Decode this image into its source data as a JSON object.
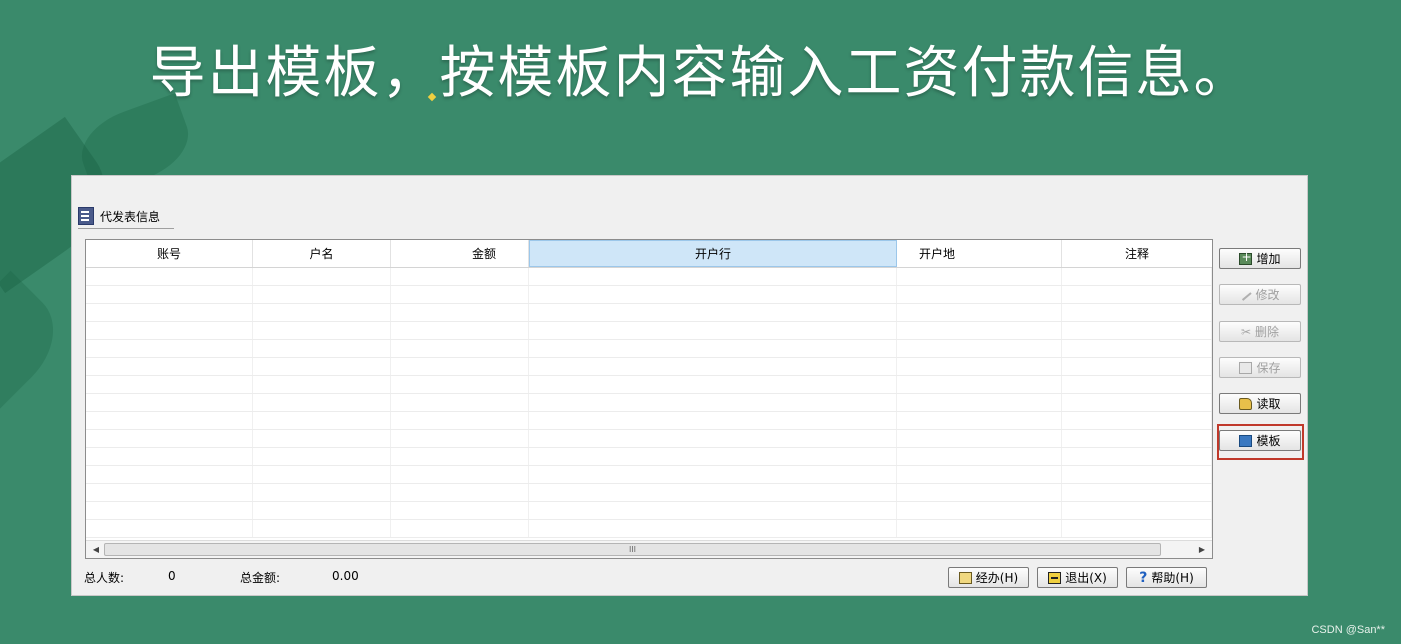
{
  "slide": {
    "title": "导出模板，按模板内容输入工资付款信息。"
  },
  "window": {
    "group_title": "代发表信息",
    "grid": {
      "columns": [
        "账号",
        "户名",
        "金额",
        "开户行",
        "开户地",
        "注释"
      ],
      "rows": [],
      "scroll_thumb": "III"
    },
    "side_buttons": {
      "add": "增加",
      "edit": "修改",
      "delete": "删除",
      "save": "保存",
      "read": "读取",
      "template": "模板"
    },
    "footer": {
      "total_people_label": "总人数:",
      "total_people_value": "0",
      "total_amount_label": "总金额:",
      "total_amount_value": "0.00",
      "handle_button": "经办(H)",
      "exit_button": "退出(X)",
      "help_button": "帮助(H)"
    }
  },
  "watermark": "CSDN @San**",
  "colors": {
    "background": "#3a8a6b",
    "highlight": "#c0392b",
    "selected_header": "#cfe6f8"
  }
}
